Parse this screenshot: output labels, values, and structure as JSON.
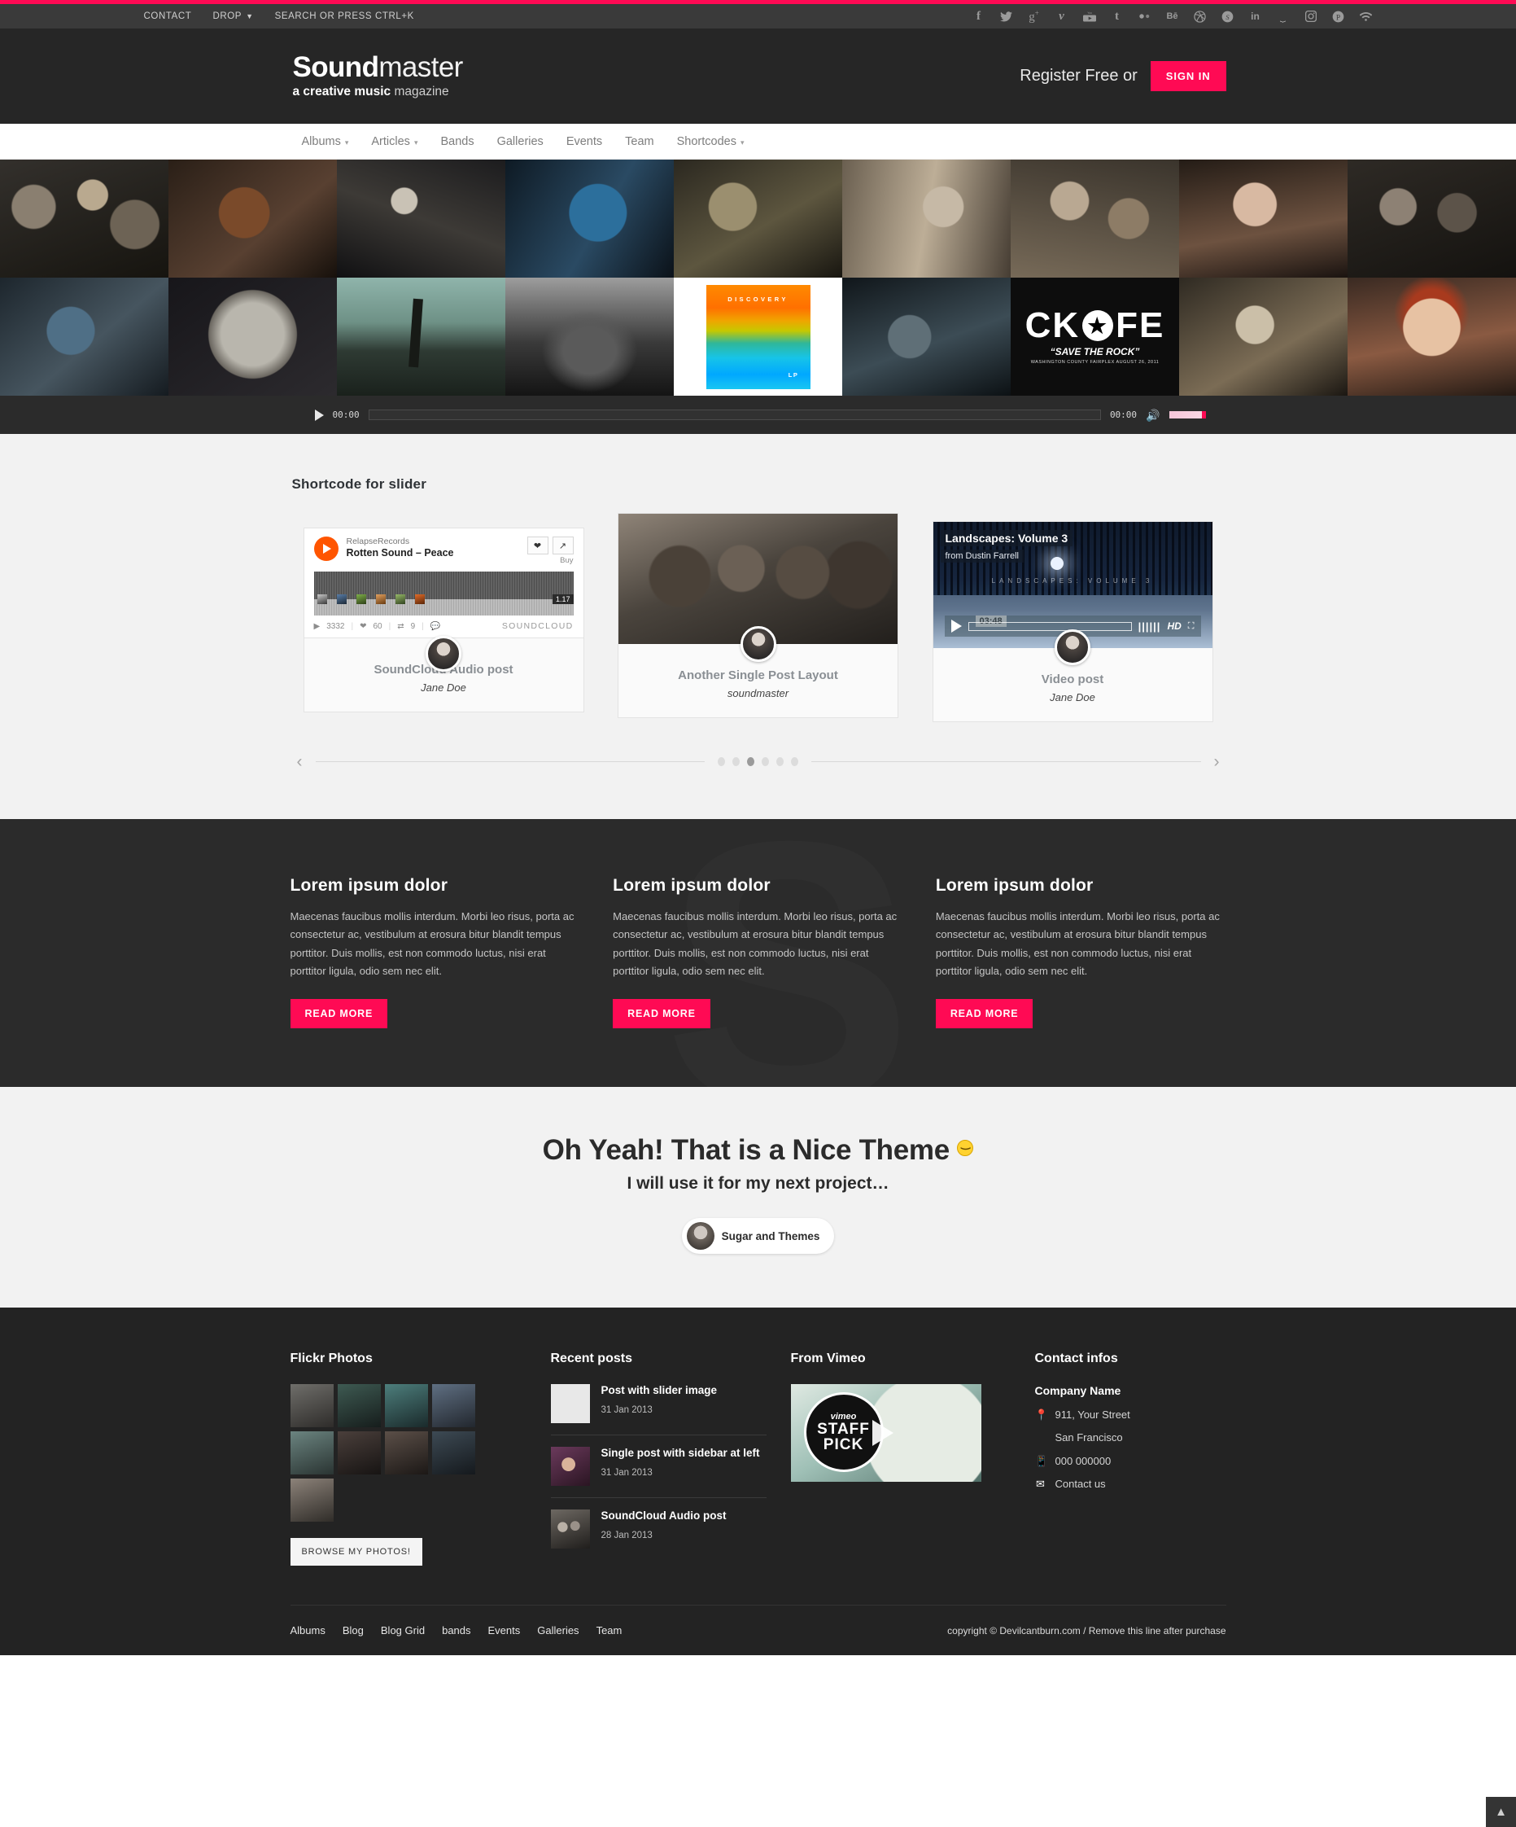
{
  "topbar": {
    "links": [
      {
        "label": "CONTACT",
        "caret": false
      },
      {
        "label": "DROP",
        "caret": true
      },
      {
        "label": "SEARCH OR PRESS CTRL+K",
        "caret": false
      }
    ],
    "socials": [
      "facebook-icon",
      "twitter-icon",
      "google-plus-icon",
      "vimeo-icon",
      "youtube-icon",
      "tumblr-icon",
      "flickr-icon",
      "behance-icon",
      "dribbble-icon",
      "skype-icon",
      "linkedin-icon",
      "dash-icon",
      "instagram-icon",
      "pinterest-icon",
      "rss-icon"
    ],
    "accent": "#ff0a54"
  },
  "header": {
    "logo_bold": "Sound",
    "logo_light": "master",
    "tagline_bold": "a creative music",
    "tagline_light": "magazine",
    "register_text": "Register Free or",
    "signin_label": "SIGN IN"
  },
  "mainnav": {
    "items": [
      {
        "label": "Albums",
        "caret": true
      },
      {
        "label": "Articles",
        "caret": true
      },
      {
        "label": "Bands",
        "caret": false
      },
      {
        "label": "Galleries",
        "caret": false
      },
      {
        "label": "Events",
        "caret": false
      },
      {
        "label": "Team",
        "caret": false
      },
      {
        "label": "Shortcodes",
        "caret": true
      }
    ]
  },
  "gallery": {
    "discovery_title": "DISCOVERY",
    "discovery_lp": "LP",
    "rock_line1": "CK",
    "rock_line2": "FE",
    "rock_star": "★",
    "rock_sub1": "“SAVE THE ROCK”",
    "rock_sub2": "WASHINGTON COUNTY FAIRPLEX    AUGUST 26, 2011"
  },
  "player": {
    "play_icon": "play-icon",
    "time_current": "00:00",
    "time_total": "00:00",
    "volume_icon": "speaker-icon"
  },
  "slider_section": {
    "title": "Shortcode for slider",
    "cards": [
      {
        "kind": "soundcloud",
        "title": "SoundCloud Audio post",
        "author": "Jane Doe",
        "widget": {
          "user": "RelapseRecords",
          "track": "Rotten Sound – Peace",
          "buy_label": "Buy",
          "like_icon": "heart-icon",
          "share_icon": "share-icon",
          "duration": "1.17",
          "plays": "3332",
          "likes": "60",
          "reposts": "9",
          "brand": "SOUNDCLOUD"
        }
      },
      {
        "kind": "photo",
        "title": "Another Single Post Layout",
        "author": "soundmaster"
      },
      {
        "kind": "video",
        "title": "Video post",
        "author": "Jane Doe",
        "video": {
          "title": "Landscapes: Volume 3",
          "from": "from Dustin Farrell",
          "watermark": "LANDSCAPES: VOLUME 3",
          "time": "03:48",
          "hd": "HD",
          "bars": "||||||",
          "fullscreen_icon": "fullscreen-icon"
        }
      }
    ],
    "nav": {
      "prev_icon": "chevron-left-icon",
      "next_icon": "chevron-right-icon",
      "dot_count": 6,
      "active_dot": 3
    }
  },
  "threecol": {
    "watermark": "S",
    "columns": [
      {
        "heading": "Lorem ipsum dolor",
        "body": "Maecenas faucibus mollis interdum. Morbi leo risus, porta ac consectetur ac, vestibulum at erosura bitur blandit tempus porttitor. Duis mollis, est non commodo luctus, nisi erat porttitor ligula, odio sem nec elit.",
        "button": "READ MORE"
      },
      {
        "heading": "Lorem ipsum dolor",
        "body": "Maecenas faucibus mollis interdum. Morbi leo risus, porta ac consectetur ac, vestibulum at erosura bitur blandit tempus porttitor. Duis mollis, est non commodo luctus, nisi erat porttitor ligula, odio sem nec elit.",
        "button": "READ MORE"
      },
      {
        "heading": "Lorem ipsum dolor",
        "body": "Maecenas faucibus mollis interdum. Morbi leo risus, porta ac consectetur ac, vestibulum at erosura bitur blandit tempus porttitor. Duis mollis, est non commodo luctus, nisi erat porttitor ligula, odio sem nec elit.",
        "button": "READ MORE"
      }
    ]
  },
  "testimonial": {
    "headline": "Oh Yeah! That is a Nice Theme",
    "subline": "I will use it for my next project…",
    "author": "Sugar and Themes"
  },
  "footer": {
    "flickr": {
      "heading": "Flickr Photos",
      "button": "BROWSE MY PHOTOS!",
      "photo_count": 9
    },
    "recent": {
      "heading": "Recent posts",
      "items": [
        {
          "title": "Post with slider image",
          "date": "31 Jan 2013"
        },
        {
          "title": "Single post with sidebar at left",
          "date": "31 Jan 2013"
        },
        {
          "title": "SoundCloud Audio post",
          "date": "28 Jan 2013"
        }
      ]
    },
    "vimeo": {
      "heading": "From Vimeo",
      "badge_brand": "vimeo",
      "badge_line1": "STAFF",
      "badge_line2": "PICK"
    },
    "contact": {
      "heading": "Contact infos",
      "company": "Company Name",
      "address1": "911, Your Street",
      "address2": "San Francisco",
      "phone": "000 000000",
      "email_label": "Contact us"
    },
    "bottom_nav": [
      "Albums",
      "Blog",
      "Blog Grid",
      "bands",
      "Events",
      "Galleries",
      "Team"
    ],
    "copyright": "copyright © Devilcantburn.com / Remove this line after purchase",
    "to_top_icon": "chevron-up-icon"
  }
}
